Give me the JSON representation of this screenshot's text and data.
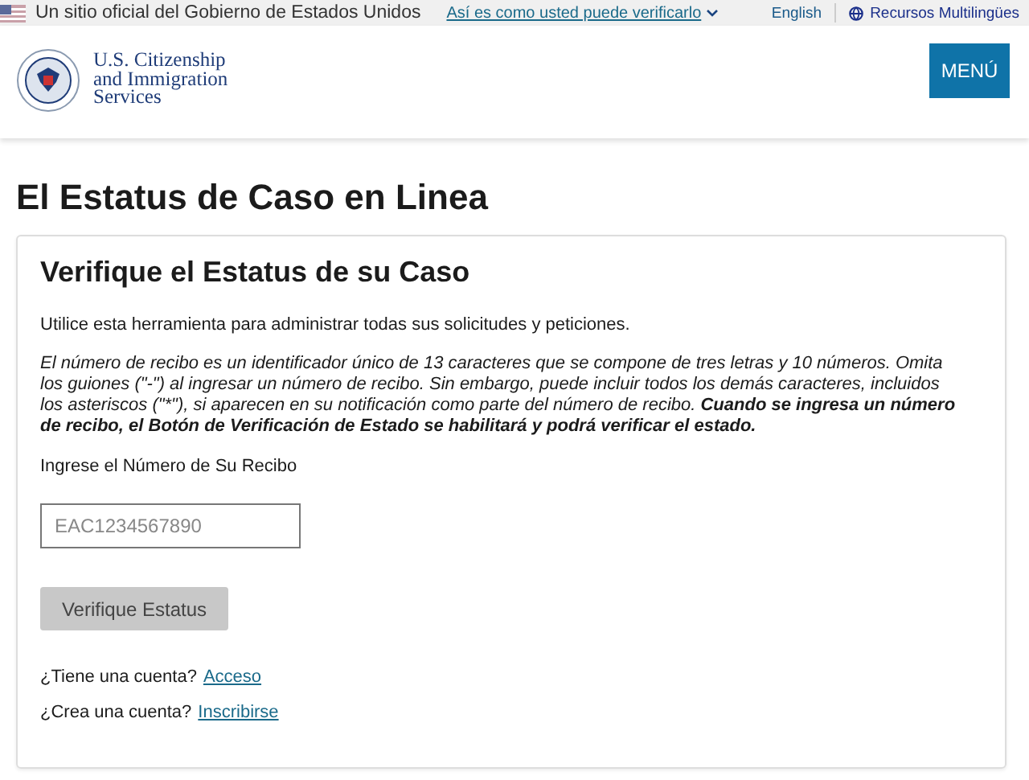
{
  "banner": {
    "text": "Un sitio oficial del Gobierno de Estados Unidos",
    "link": "Así es como usted puede verificarlo",
    "expanded": false,
    "language": "English",
    "resources": "Recursos Multilingües"
  },
  "header": {
    "agency_lines": [
      "U.S. Citizenship",
      "and Immigration",
      "Services"
    ],
    "menu_button": "MENÚ"
  },
  "page_title": "El Estatus de Caso en Linea",
  "card": {
    "title": "Verifique el Estatus de su Caso",
    "intro": "Utilice esta herramienta para administrar todas sus solicitudes y peticiones.",
    "note": "El número de recibo es un identificador único de 13 caracteres que se compone de tres letras y 10 números. Omita los guiones (\"-\") al ingresar un número de recibo. Sin embargo, puede incluir todos los demás caracteres, incluidos los asteriscos (\"*\"), si aparecen en su notificación como parte del número de recibo. **Cuando se ingresa un número de recibo, el Botón de Verificación de Estado se habilitará y podrá verificar el estado.**",
    "field_label": "Ingrese el Número de Su Recibo",
    "field_placeholder": "EAC1234567890",
    "submit": {
      "label": "Verifique Estatus",
      "disabled": true
    },
    "links": [
      {
        "prompt": "¿Tiene una cuenta?",
        "link": "Acceso"
      },
      {
        "prompt": "¿Crea una cuenta?",
        "link": "Inscribirse"
      }
    ]
  }
}
